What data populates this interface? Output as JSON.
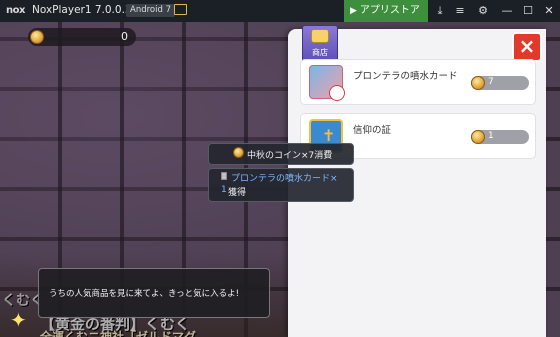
{
  "window": {
    "logo": "nox",
    "title": "NoxPlayer1 7.0.0.3",
    "android_badge": "Android 7",
    "store_button": "アプリストア",
    "controls": [
      "gift-icon",
      "menu-icon",
      "gear-icon",
      "minimize-icon",
      "maximize-icon",
      "close-icon"
    ]
  },
  "hud": {
    "coin_count": "0"
  },
  "shop": {
    "badge_label": "商店",
    "close": "×",
    "items": [
      {
        "name": "プロンテラの噴水カード",
        "stock": "7",
        "thumb": "card-icon"
      },
      {
        "name": "信仰の証",
        "stock": "1",
        "thumb": "holy-book-icon"
      }
    ]
  },
  "tooltips": {
    "cost": "中秋のコイン×7消費",
    "gain_item": "プロンテラの噴水カード×",
    "gain_qty": "1",
    "gain_suffix": "獲得"
  },
  "dialogue": {
    "text": "うちの人気商品を見に来てよ、きっと気に入るよ!"
  },
  "background_signs": {
    "line1": "くむく",
    "line2": "【黄金の番判】くむく",
    "line3": "全運くむニ神社「ゼルドマグ"
  },
  "colors": {
    "store_green": "#3d8f3d",
    "close_red": "#e23a2a",
    "badge_purple": "#6a5bc0",
    "highlight_blue": "#7ab8ff"
  }
}
